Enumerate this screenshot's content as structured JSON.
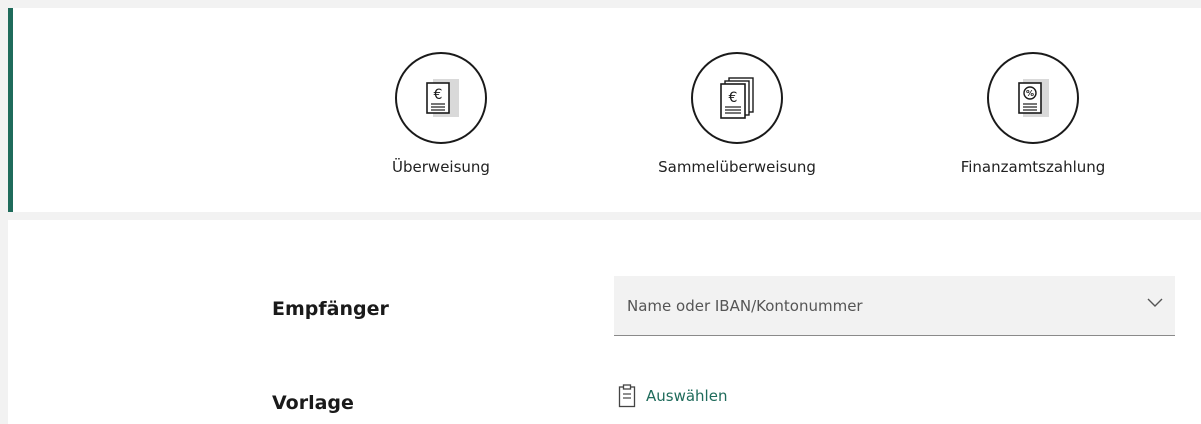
{
  "payment_types": [
    {
      "label": "Überweisung",
      "icon": "euro-document-icon"
    },
    {
      "label": "Sammelüberweisung",
      "icon": "multiple-euro-documents-icon"
    },
    {
      "label": "Finanzamtszahlung",
      "icon": "percent-document-icon"
    }
  ],
  "form": {
    "recipient_label": "Empfänger",
    "recipient_placeholder": "Name oder IBAN/Kontonummer",
    "template_label": "Vorlage",
    "template_action": "Auswählen"
  },
  "colors": {
    "accent": "#1f6b5b",
    "background": "#f2f2f2",
    "card": "#ffffff"
  }
}
